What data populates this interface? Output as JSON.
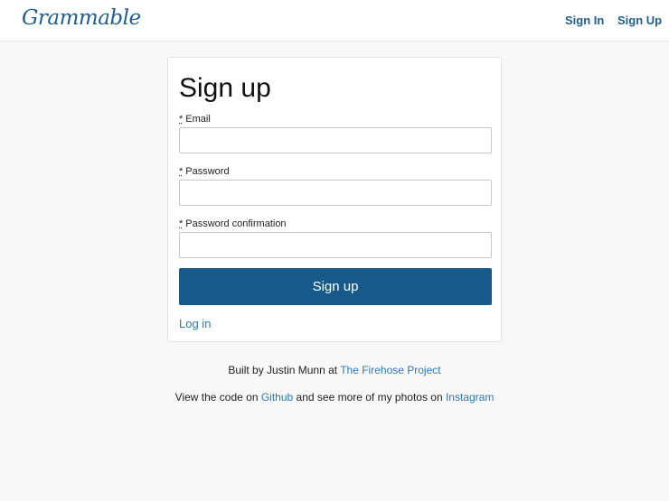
{
  "navbar": {
    "brand": "Grammable",
    "sign_in": "Sign In",
    "sign_up": "Sign Up"
  },
  "form": {
    "title": "Sign up",
    "required_marker": "*",
    "fields": [
      {
        "label": "Email",
        "value": "",
        "placeholder": ""
      },
      {
        "label": "Password",
        "value": "",
        "placeholder": ""
      },
      {
        "label": "Password confirmation",
        "value": "",
        "placeholder": ""
      }
    ],
    "submit_label": "Sign up",
    "login_link": "Log in"
  },
  "footer": {
    "line1_prefix": "Built by Justin Munn at ",
    "line1_link": "The Firehose Project",
    "line2_prefix": "View the code on ",
    "line2_link1": "Github",
    "line2_middle": " and see more of my photos on ",
    "line2_link2": "Instagram"
  },
  "colors": {
    "brand": "#1f5e8f",
    "button": "#175a8a",
    "link": "#2d7ab8",
    "background": "#f8f8f8"
  }
}
